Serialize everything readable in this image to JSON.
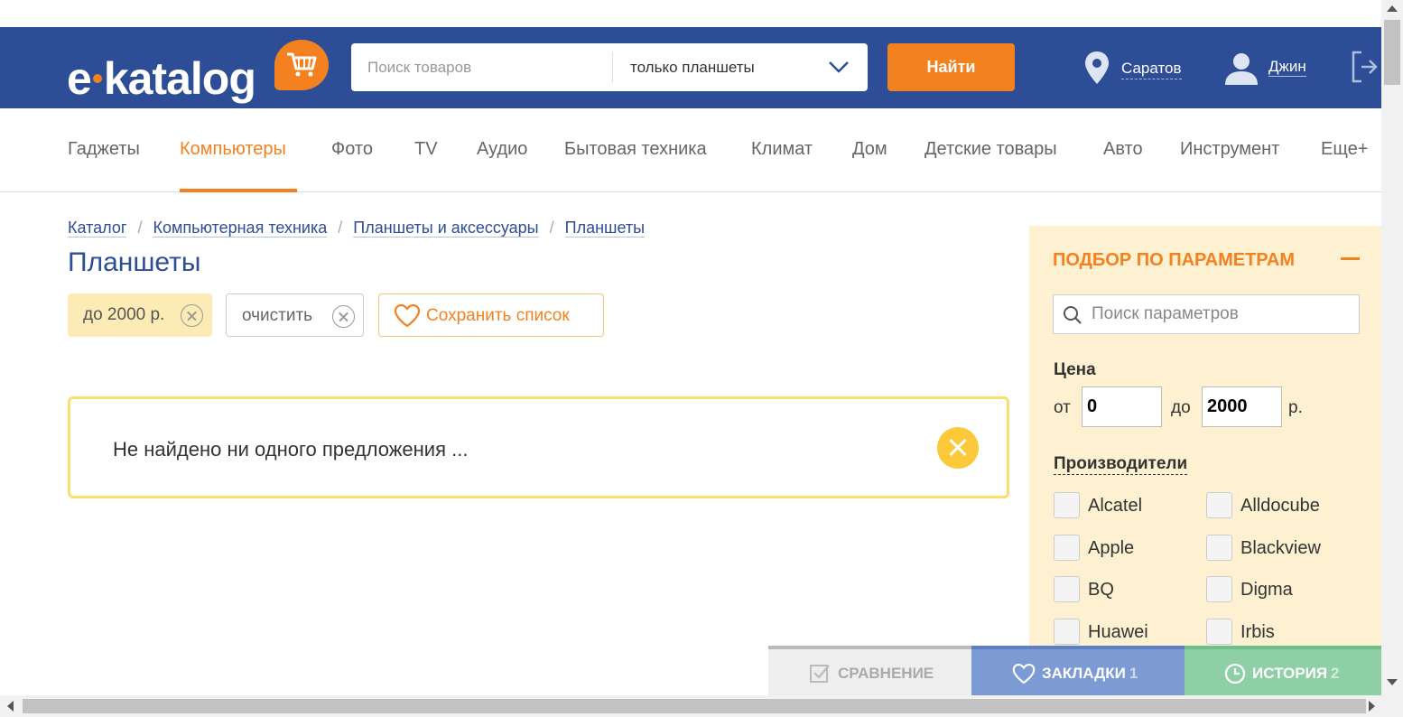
{
  "colors": {
    "header_bg": "#2e4d97",
    "accent": "#f48120",
    "filter_bg": "#fdf1d2",
    "message_border": "#fadf6f"
  },
  "header": {
    "logo_text": "e·katalog",
    "search_placeholder": "Поиск товаров",
    "search_scope": "только планшеты",
    "find_button": "Найти",
    "city": "Саратов",
    "user": "Джин",
    "icons": [
      "cart-icon",
      "chevron-down-icon",
      "location-pin-icon",
      "user-icon",
      "logout-icon"
    ]
  },
  "nav": {
    "items": [
      {
        "label": "Гаджеты"
      },
      {
        "label": "Компьютеры",
        "active": true
      },
      {
        "label": "Фото"
      },
      {
        "label": "TV"
      },
      {
        "label": "Аудио"
      },
      {
        "label": "Бытовая техника"
      },
      {
        "label": "Климат"
      },
      {
        "label": "Дом"
      },
      {
        "label": "Детские товары"
      },
      {
        "label": "Авто"
      },
      {
        "label": "Инструмент"
      },
      {
        "label": "Еще+"
      }
    ]
  },
  "breadcrumb": [
    {
      "label": "Каталог"
    },
    {
      "label": "Компьютерная техника"
    },
    {
      "label": "Планшеты и аксессуары"
    },
    {
      "label": "Планшеты"
    }
  ],
  "breadcrumb_sep": "/",
  "page_title": "Планшеты",
  "chips": {
    "price": "до 2000 р.",
    "clear": "очистить",
    "save": "Сохранить список"
  },
  "message": "Не найдено ни одного предложения ...",
  "filter": {
    "title": "ПОДБОР ПО ПАРАМЕТРАМ",
    "search_placeholder": "Поиск параметров",
    "price_label": "Цена",
    "from_label": "от",
    "from_value": "0",
    "to_label": "до",
    "to_value": "2000",
    "currency": "р.",
    "makers_label": "Производители",
    "makers": [
      {
        "label": "Alcatel",
        "checked": false
      },
      {
        "label": "Alldocube",
        "checked": false
      },
      {
        "label": "Apple",
        "checked": false
      },
      {
        "label": "Blackview",
        "checked": false
      },
      {
        "label": "BQ",
        "checked": false
      },
      {
        "label": "Digma",
        "checked": false
      },
      {
        "label": "Huawei",
        "checked": false
      },
      {
        "label": "Irbis",
        "checked": false
      }
    ]
  },
  "bottom_bar": {
    "compare": {
      "label": "СРАВНЕНИЕ"
    },
    "bookmarks": {
      "label": "ЗАКЛАДКИ",
      "count": "1"
    },
    "history": {
      "label": "ИСТОРИЯ",
      "count": "2"
    }
  }
}
